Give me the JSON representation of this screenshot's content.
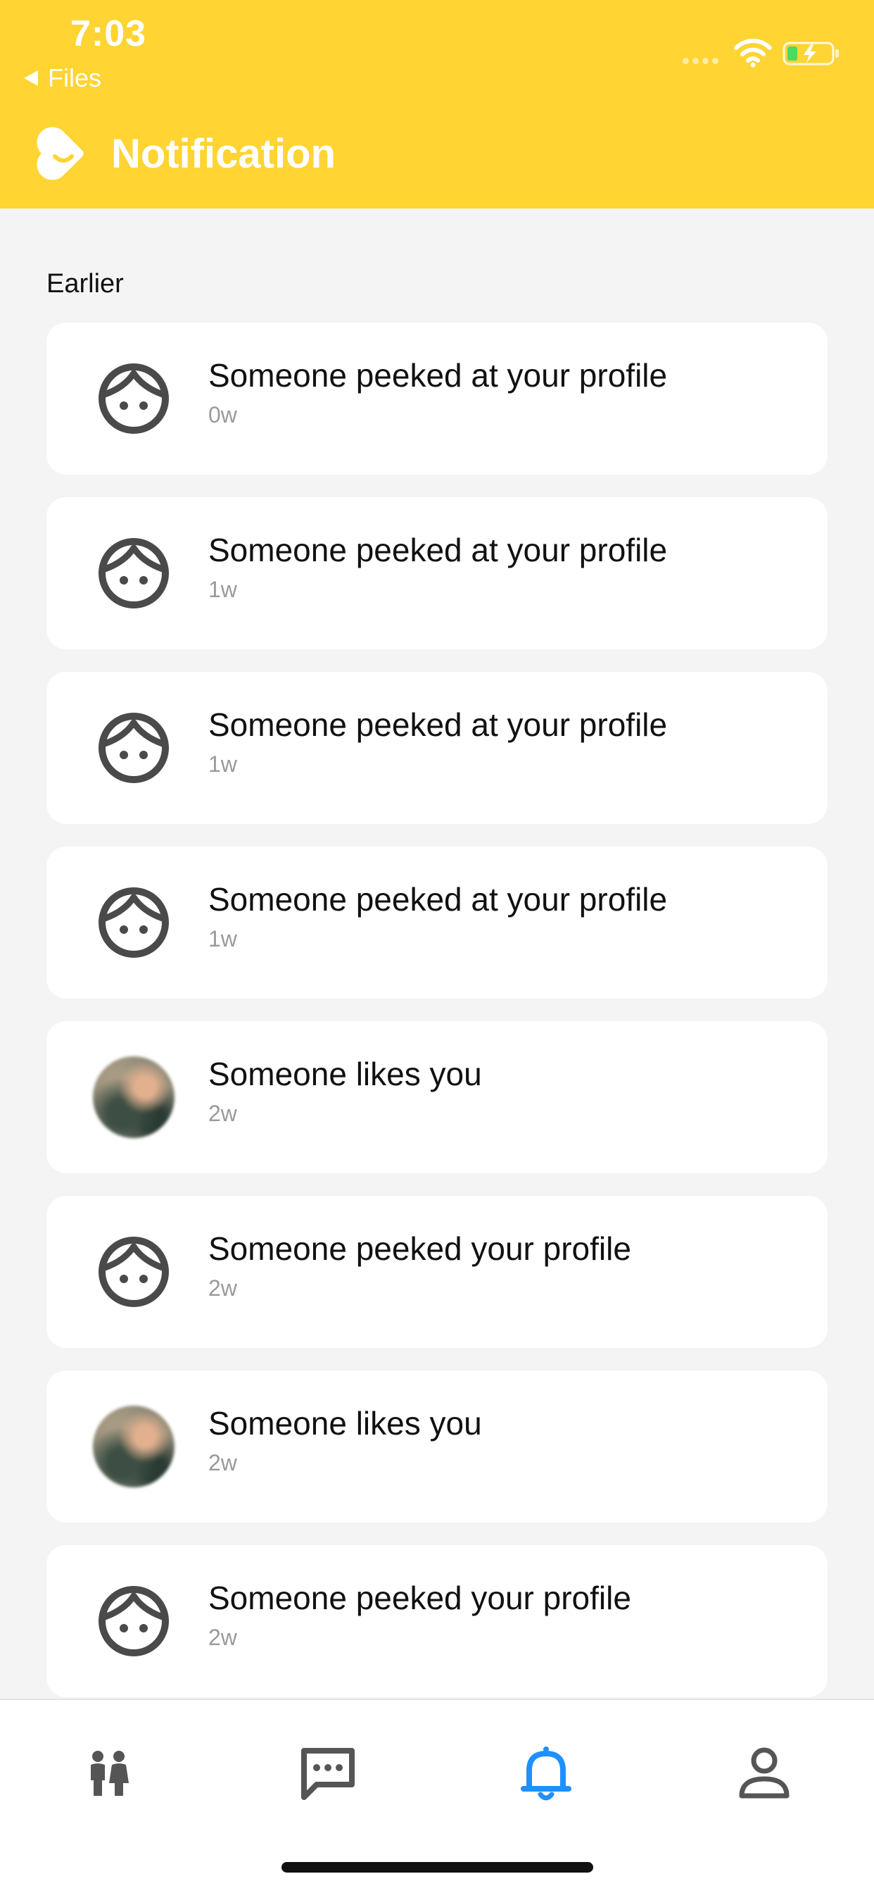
{
  "status_bar": {
    "time": "7:03",
    "back_app_label": "Files"
  },
  "header": {
    "title": "Notification",
    "background_color": "#ffd433"
  },
  "section": {
    "label": "Earlier"
  },
  "notifications": [
    {
      "title": "Someone peeked at your profile",
      "time": "0w",
      "icon": "face-outline-icon"
    },
    {
      "title": "Someone peeked at your profile",
      "time": "1w",
      "icon": "face-outline-icon"
    },
    {
      "title": "Someone peeked at your profile",
      "time": "1w",
      "icon": "face-outline-icon"
    },
    {
      "title": "Someone peeked at your profile",
      "time": "1w",
      "icon": "face-outline-icon"
    },
    {
      "title": "Someone likes you",
      "time": "2w",
      "icon": "blurred-photo-avatar"
    },
    {
      "title": "Someone peeked your profile",
      "time": "2w",
      "icon": "face-outline-icon"
    },
    {
      "title": "Someone likes you",
      "time": "2w",
      "icon": "blurred-photo-avatar"
    },
    {
      "title": "Someone peeked your profile",
      "time": "2w",
      "icon": "face-outline-icon"
    }
  ],
  "bottom_nav": {
    "items": [
      {
        "icon": "people-icon",
        "active": false
      },
      {
        "icon": "chat-icon",
        "active": false
      },
      {
        "icon": "bell-icon",
        "active": true
      },
      {
        "icon": "profile-icon",
        "active": false
      }
    ],
    "active_color": "#1e90ff",
    "inactive_color": "#555555"
  }
}
